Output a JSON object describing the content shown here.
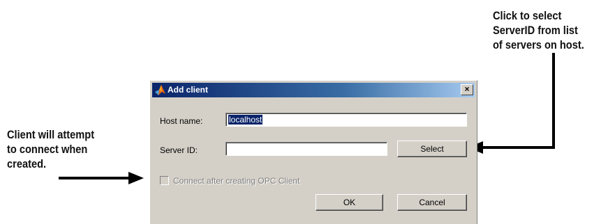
{
  "annotations": {
    "right": [
      "Click to select",
      "ServerID from list",
      "of servers on host."
    ],
    "left": [
      "Client will attempt",
      "to connect when",
      "created."
    ]
  },
  "dialog": {
    "title": "Add client",
    "close_glyph": "×",
    "host_label": "Host name:",
    "host_value": "localhost",
    "server_label": "Server ID:",
    "server_value": "",
    "select_label": "Select",
    "checkbox_label": "Connect after creating OPC Client",
    "checkbox_checked": false,
    "ok_label": "OK",
    "cancel_label": "Cancel"
  },
  "icons": {
    "title_icon": "matlab-logo-icon",
    "close": "close-icon",
    "arrow_right": "arrow-right-icon",
    "arrow_left": "arrow-left-icon"
  },
  "colors": {
    "titlebar_start": "#0a246a",
    "titlebar_end": "#a6caf0",
    "dialog_face": "#d4d0c8",
    "selection": "#0a246a",
    "disabled_text": "#808080"
  }
}
